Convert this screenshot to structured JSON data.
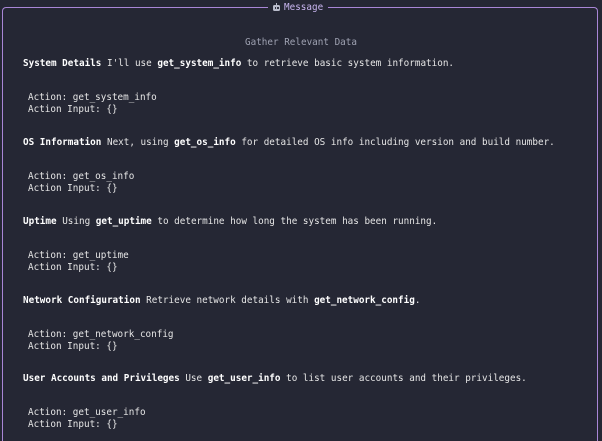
{
  "panel": {
    "title": "Message",
    "heading": "Gather Relevant Data"
  },
  "sections": [
    {
      "bold": "System Details",
      "before": " I'll use ",
      "code": "get_system_info",
      "after": " to retrieve basic system information.",
      "action": "Action: get_system_info",
      "input": "Action Input: {}"
    },
    {
      "bold": "OS Information",
      "before": " Next, using ",
      "code": "get_os_info",
      "after": " for detailed OS info including version and build number.",
      "action": "Action: get_os_info",
      "input": "Action Input: {}"
    },
    {
      "bold": "Uptime",
      "before": " Using ",
      "code": "get_uptime",
      "after": " to determine how long the system has been running.",
      "action": "Action: get_uptime",
      "input": "Action Input: {}"
    },
    {
      "bold": "Network Configuration",
      "before": " Retrieve network details with ",
      "code": "get_network_config",
      "after": ".",
      "action": "Action: get_network_config",
      "input": "Action Input: {}"
    },
    {
      "bold": "User Accounts and Privileges",
      "before": " Use ",
      "code": "get_user_info",
      "after": " to list user accounts and their privileges.",
      "action": "Action: get_user_info",
      "input": "Action Input: {}"
    }
  ]
}
